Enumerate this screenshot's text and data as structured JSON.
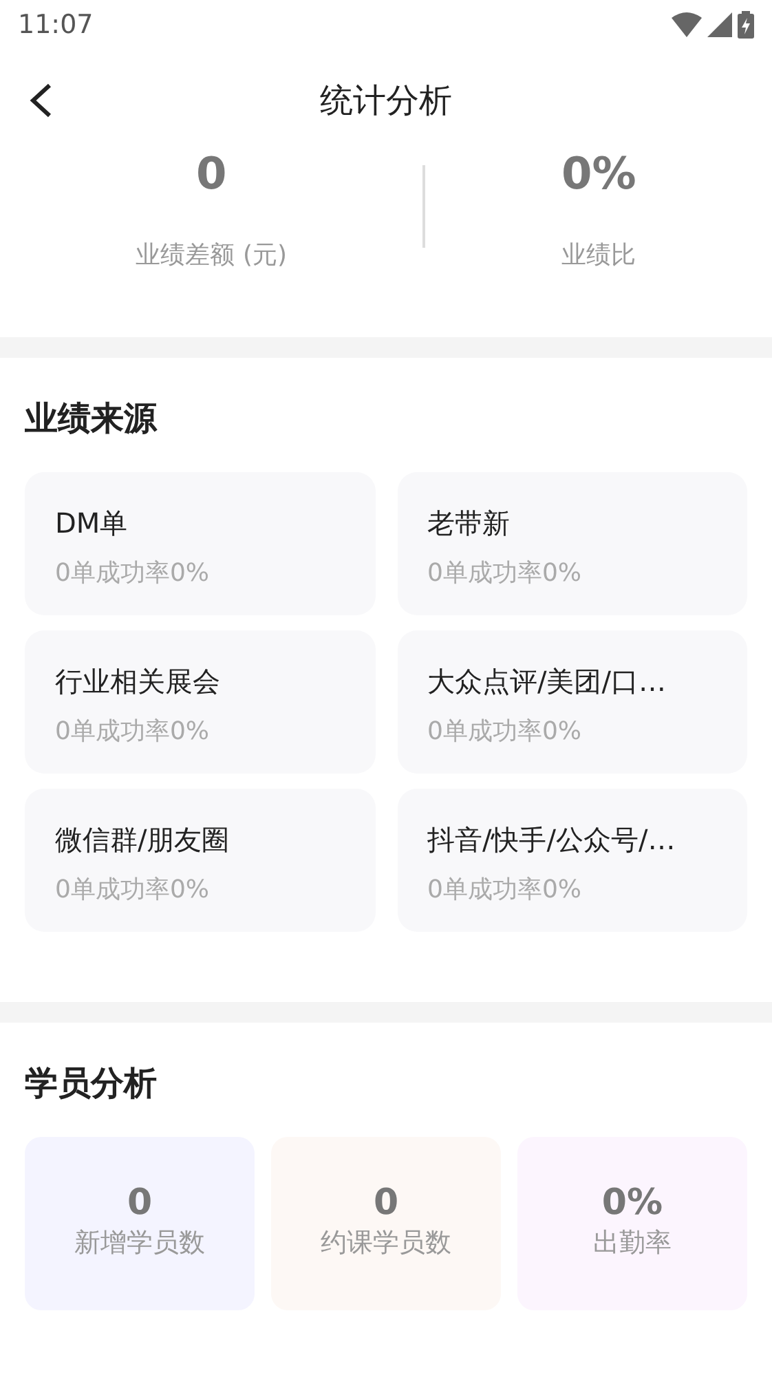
{
  "status_bar": {
    "time": "11:07"
  },
  "header": {
    "title": "统计分析"
  },
  "summary": [
    {
      "value": "0",
      "label": "业绩差额 (元)"
    },
    {
      "value": "0%",
      "label": "业绩比"
    }
  ],
  "sources": {
    "title": "业绩来源",
    "items": [
      {
        "name": "DM单",
        "stat": "0单成功率0%"
      },
      {
        "name": "老带新",
        "stat": "0单成功率0%"
      },
      {
        "name": "行业相关展会",
        "stat": "0单成功率0%"
      },
      {
        "name": "大众点评/美团/口…",
        "stat": "0单成功率0%"
      },
      {
        "name": "微信群/朋友圈",
        "stat": "0单成功率0%"
      },
      {
        "name": "抖音/快手/公众号/…",
        "stat": "0单成功率0%"
      }
    ]
  },
  "students": {
    "title": "学员分析",
    "items": [
      {
        "value": "0",
        "label": "新增学员数",
        "color": "#f4f4ff"
      },
      {
        "value": "0",
        "label": "约课学员数",
        "color": "#fdf8f5"
      },
      {
        "value": "0%",
        "label": "出勤率",
        "color": "#fcf5fe"
      }
    ]
  }
}
